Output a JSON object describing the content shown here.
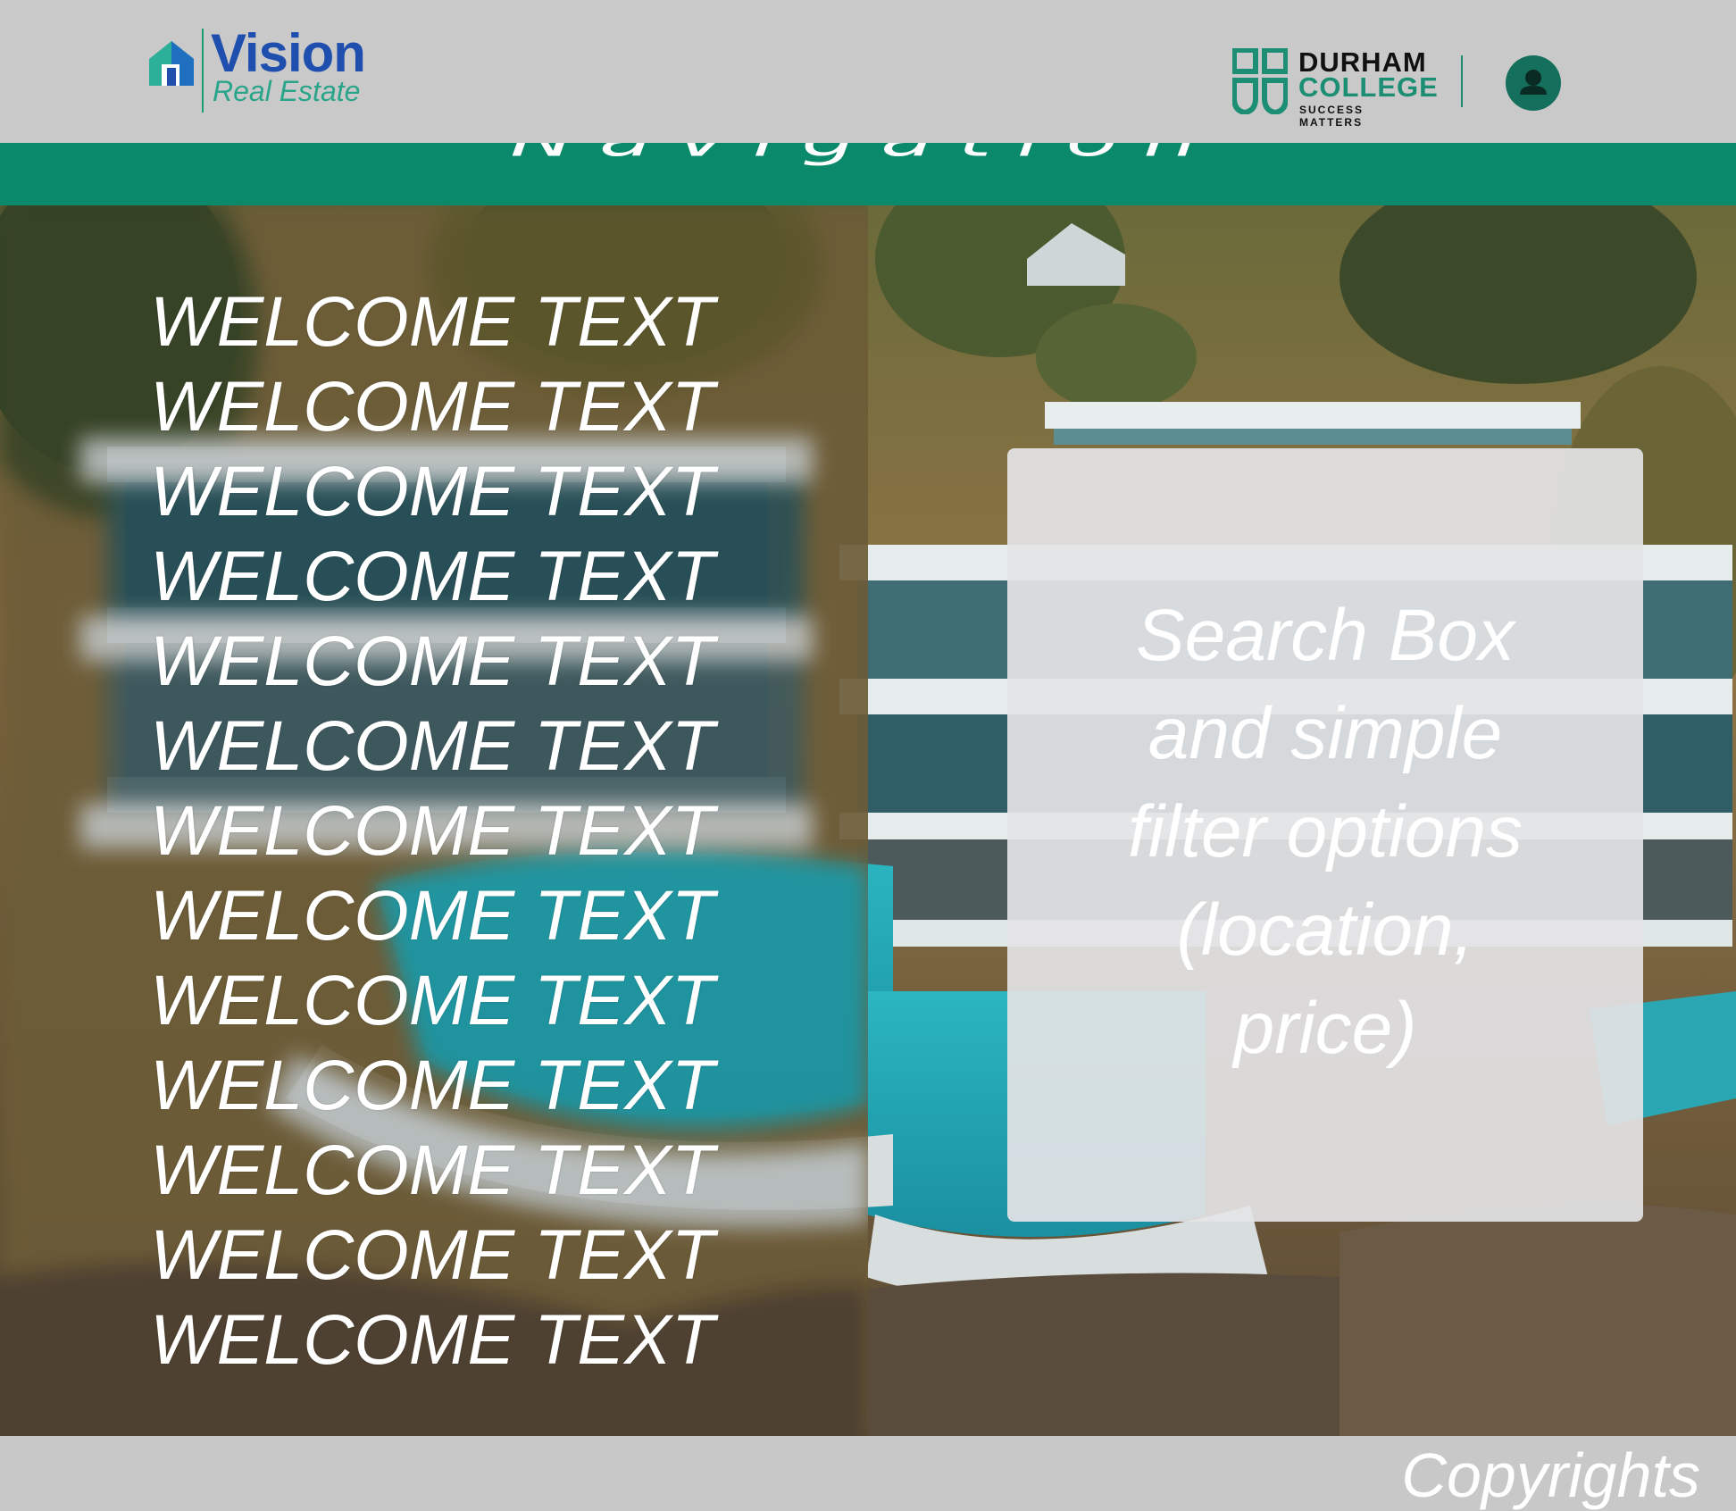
{
  "header": {
    "logo": {
      "name": "Vision",
      "tagline": "Real Estate"
    },
    "partner": {
      "line1": "DURHAM",
      "line2": "COLLEGE",
      "tagline": "SUCCESS MATTERS"
    },
    "user_icon": "user-avatar-icon"
  },
  "nav": {
    "label": "Navigation"
  },
  "hero": {
    "welcome_lines": [
      "WELCOME TEXT",
      "WELCOME TEXT",
      "WELCOME TEXT",
      "WELCOME TEXT",
      "WELCOME TEXT",
      "WELCOME TEXT",
      "WELCOME TEXT",
      "WELCOME TEXT",
      "WELCOME TEXT",
      "WELCOME TEXT",
      "WELCOME TEXT",
      "WELCOME TEXT",
      "WELCOME TEXT"
    ],
    "search_box": {
      "lines": [
        "Search Box",
        "and simple",
        "filter options",
        "(location,",
        "price)"
      ]
    }
  },
  "footer": {
    "copyright": "Copyrights"
  },
  "colors": {
    "brand_green": "#0b8a6b",
    "header_bg": "#c9c9c9",
    "vision_blue": "#1f4fae",
    "vision_teal": "#2aa58a",
    "durham_green": "#1b8e73"
  }
}
